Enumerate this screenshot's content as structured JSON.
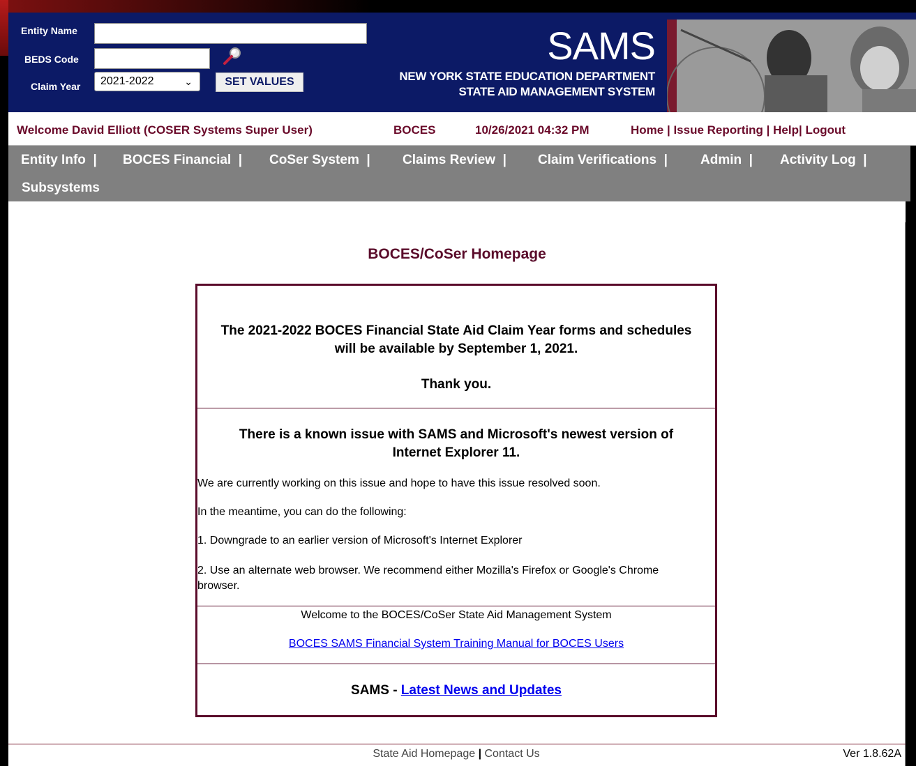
{
  "header": {
    "entity_name_label": "Entity Name",
    "entity_name_value": "",
    "beds_code_label": "BEDS Code",
    "beds_code_value": "",
    "claim_year_label": "Claim Year",
    "claim_year_value": "2021-2022",
    "set_values_label": "SET VALUES",
    "app_title": "SAMS",
    "subtitle_1": "NEW YORK STATE EDUCATION DEPARTMENT",
    "subtitle_2": "STATE AID MANAGEMENT SYSTEM"
  },
  "welcome_bar": {
    "welcome": "Welcome David Elliott  (COSER Systems Super User)",
    "entity_type": "BOCES",
    "datetime": "10/26/2021 04:32 PM",
    "links": [
      "Home",
      "Issue Reporting",
      "Help",
      "Logout"
    ]
  },
  "nav": {
    "items": [
      "Entity Info",
      "BOCES Financial",
      "CoSer System",
      "Claims Review",
      "Claim Verifications",
      "Admin",
      "Activity Log",
      "Subsystems"
    ]
  },
  "main": {
    "page_title": "BOCES/CoSer Homepage",
    "notice1_line1": "The 2021-2022 BOCES Financial State Aid Claim Year forms and schedules",
    "notice1_line2": "will be available by September 1, 2021.",
    "notice1_thanks": "Thank you.",
    "notice2_head1": "There is a known issue with SAMS and Microsoft's newest version of",
    "notice2_head2": "Internet Explorer 11.",
    "notice2_p1": "We are currently working on this issue and hope to have this issue resolved soon.",
    "notice2_p2": "In the meantime, you can do the following:",
    "notice2_p3": "1. Downgrade to an earlier version of Microsoft's Internet Explorer",
    "notice2_p4": "2. Use an alternate web browser. We recommend either Mozilla's Firefox or Google's Chrome browser.",
    "welcome_text": "Welcome to the BOCES/CoSer State Aid Management System",
    "manual_link": "BOCES SAMS Financial System Training Manual for BOCES Users",
    "news_prefix": "SAMS - ",
    "news_link": "Latest News and Updates"
  },
  "footer": {
    "state_aid_link": "State Aid Homepage",
    "contact_link": "Contact Us",
    "version": "Ver 1.8.62A"
  },
  "colors": {
    "header_bg": "#0c1a66",
    "accent_maroon": "#5a0b2a",
    "nav_bg": "#808080"
  }
}
